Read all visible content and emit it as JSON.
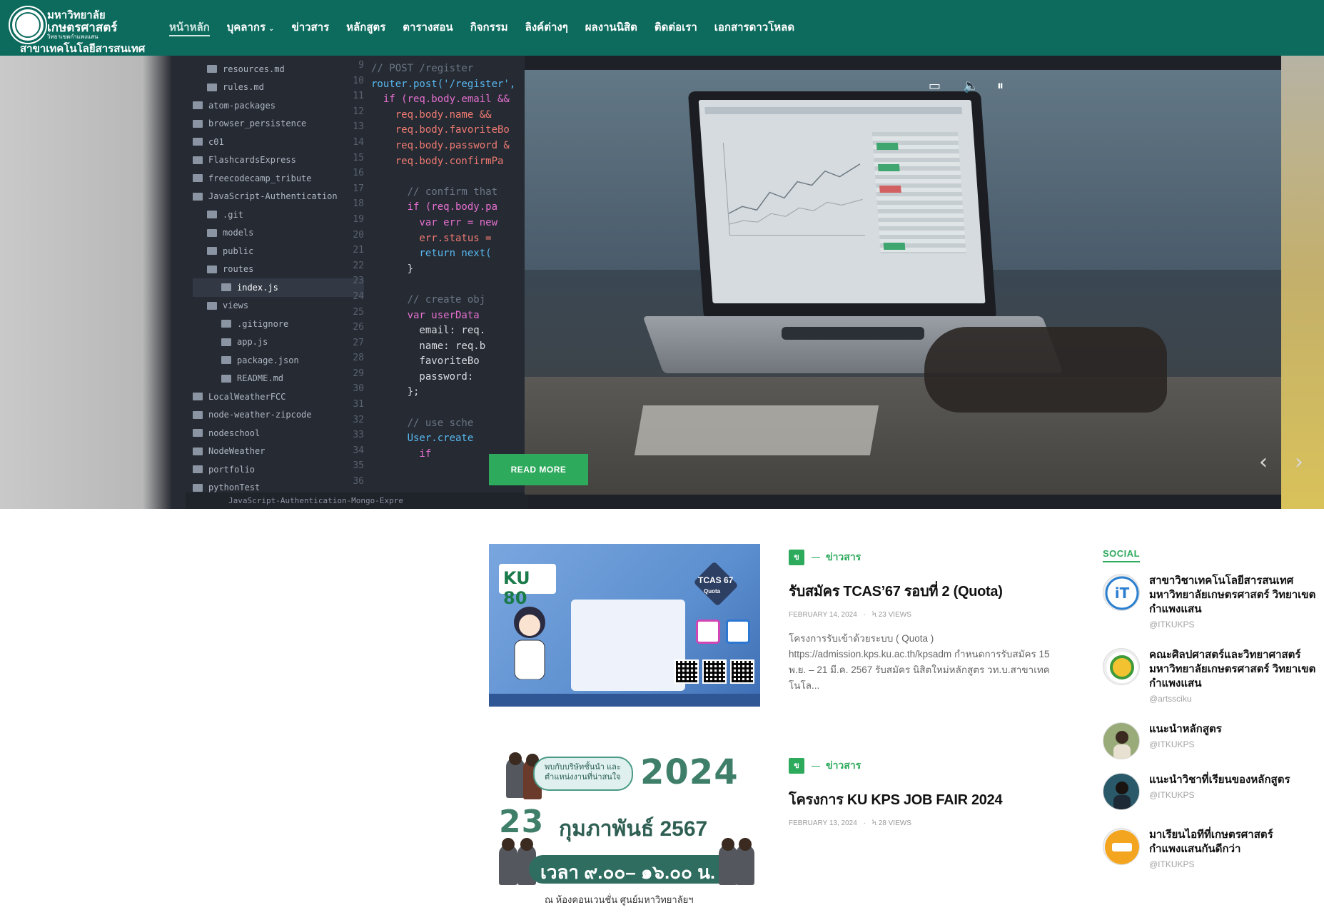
{
  "header": {
    "logo": {
      "line1": "มหาวิทยาลัย",
      "line2": "เกษตรศาสตร์",
      "line3": "วิทยาเขตกำแพงแสน",
      "line4": "สาขาเทคโนโลยีสารสนเทศ"
    },
    "nav": [
      {
        "label": "หน้าหลัก",
        "active": true
      },
      {
        "label": "บุคลากร",
        "dropdown": true
      },
      {
        "label": "ข่าวสาร"
      },
      {
        "label": "หลักสูตร"
      },
      {
        "label": "ตารางสอน"
      },
      {
        "label": "กิจกรรม"
      },
      {
        "label": "ลิงค์ต่างๆ"
      },
      {
        "label": "ผลงานนิสิต"
      },
      {
        "label": "ติดต่อเรา"
      },
      {
        "label": "เอกสารดาวโหลด"
      }
    ],
    "colors": {
      "bar": "#0d6b5e",
      "accent": "#2eaa5c"
    }
  },
  "hero": {
    "file_tree": [
      "resources.md",
      "rules.md",
      "atom-packages",
      "browser_persistence",
      "c01",
      "FlashcardsExpress",
      "freecodecamp_tribute",
      "JavaScript-Authentication",
      ".git",
      "models",
      "public",
      "routes",
      "index.js",
      "views",
      ".gitignore",
      "app.js",
      "package.json",
      "README.md",
      "LocalWeatherFCC",
      "node-weather-zipcode",
      "nodeschool",
      "NodeWeather",
      "portfolio",
      "pythonTest"
    ],
    "line_numbers": [
      "9",
      "10",
      "11",
      "12",
      "13",
      "14",
      "15",
      "16",
      "17",
      "18",
      "19",
      "20",
      "21",
      "22",
      "23",
      "24",
      "25",
      "26",
      "27",
      "28",
      "29",
      "30",
      "31",
      "32",
      "33",
      "34",
      "35",
      "36"
    ],
    "code_lines": [
      {
        "t": "// POST /register",
        "c": "c-com"
      },
      {
        "t": "router.post('/register',",
        "c": "c-fn"
      },
      {
        "t": "  if (req.body.email &&",
        "c": "c-kw"
      },
      {
        "t": "    req.body.name &&",
        "c": "c-var"
      },
      {
        "t": "    req.body.favoriteBo",
        "c": "c-var"
      },
      {
        "t": "    req.body.password &",
        "c": "c-var"
      },
      {
        "t": "    req.body.confirmPa",
        "c": "c-var"
      },
      {
        "t": "",
        "c": "c-pl"
      },
      {
        "t": "      // confirm that",
        "c": "c-com"
      },
      {
        "t": "      if (req.body.pa",
        "c": "c-kw"
      },
      {
        "t": "        var err = new",
        "c": "c-kw"
      },
      {
        "t": "        err.status =",
        "c": "c-var"
      },
      {
        "t": "        return next(",
        "c": "c-fn"
      },
      {
        "t": "      }",
        "c": "c-pl"
      },
      {
        "t": "",
        "c": "c-pl"
      },
      {
        "t": "      // create obj",
        "c": "c-com"
      },
      {
        "t": "      var userData",
        "c": "c-kw"
      },
      {
        "t": "        email: req.",
        "c": "c-pl"
      },
      {
        "t": "        name: req.b",
        "c": "c-pl"
      },
      {
        "t": "        favoriteBo",
        "c": "c-pl"
      },
      {
        "t": "        password:",
        "c": "c-pl"
      },
      {
        "t": "      };",
        "c": "c-pl"
      },
      {
        "t": "",
        "c": "c-pl"
      },
      {
        "t": "      // use sche",
        "c": "c-com"
      },
      {
        "t": "      User.create",
        "c": "c-fn"
      },
      {
        "t": "        if",
        "c": "c-kw"
      }
    ],
    "status_bar": "JavaScript-Authentication-Mongo-Expre",
    "read_more": "READ MORE",
    "controls": {
      "prev": "‹",
      "next": "›"
    }
  },
  "posts": [
    {
      "category_badge": "ข",
      "category": "ข่าวสาร",
      "title": "รับสมัคร TCAS’67 รอบที่ 2 (Quota)",
      "date": "FEBRUARY 14, 2024",
      "views": "23 VIEWS",
      "excerpt": "โครงการรับเข้าด้วยระบบ ( Quota ) https://admission.kps.ku.ac.th/kpsadm กำหนดการรับสมัคร 15 พ.ย. – 21 มี.ค. 2567 รับสมัคร นิสิตใหม่หลักสูตร วท.บ.สาขาเทคโนโล...",
      "image": {
        "logo": "KU 80",
        "badge": "TCAS 67",
        "badge_sub": "Quota"
      }
    },
    {
      "category_badge": "ข",
      "category": "ข่าวสาร",
      "title": "โครงการ KU KPS JOB FAIR 2024",
      "date": "FEBRUARY 13, 2024",
      "views": "28 VIEWS",
      "excerpt": "",
      "image": {
        "bubble": "พบกับบริษัทชั้นนำ และตำแหน่งงานที่น่าสนใจ",
        "year": "2024",
        "day": "23",
        "month": "กุมภาพันธ์ 2567",
        "time": "เวลา ๙.๐๐– ๑๖.๐๐ น.",
        "location": "ณ ห้องคอนเวนชั่น ศูนย์มหาวิทยาลัยฯ"
      }
    }
  ],
  "social": {
    "title": "SOCIAL",
    "items": [
      {
        "name": "สาขาวิชาเทคโนโลยีสารสนเทศ มหาวิทยาลัยเกษตรศาสตร์ วิทยาเขตกำแพงแสน",
        "handle": "@ITKUKPS",
        "avatar": "it-logo",
        "color": "#2b7fd0"
      },
      {
        "name": "คณะศิลปศาสตร์และวิทยาศาสตร์ มหาวิทยาลัยเกษตรศาสตร์ วิทยาเขตกำแพงแสน",
        "handle": "@artssciku",
        "avatar": "faculty-logo",
        "color": "#3f9a3a"
      },
      {
        "name": "แนะนำหลักสูตร",
        "handle": "@ITKUKPS",
        "avatar": "student-photo",
        "color": "#8a9a6a"
      },
      {
        "name": "แนะนำวิชาที่เรียนของหลักสูตร",
        "handle": "@ITKUKPS",
        "avatar": "student-photo",
        "color": "#2a5a6a"
      },
      {
        "name": "มาเรียนไอทีที่เกษตรศาสตร์กำแพงแสนกันดีกว่า",
        "handle": "@ITKUKPS",
        "avatar": "promo-logo",
        "color": "#f0a020"
      }
    ]
  }
}
